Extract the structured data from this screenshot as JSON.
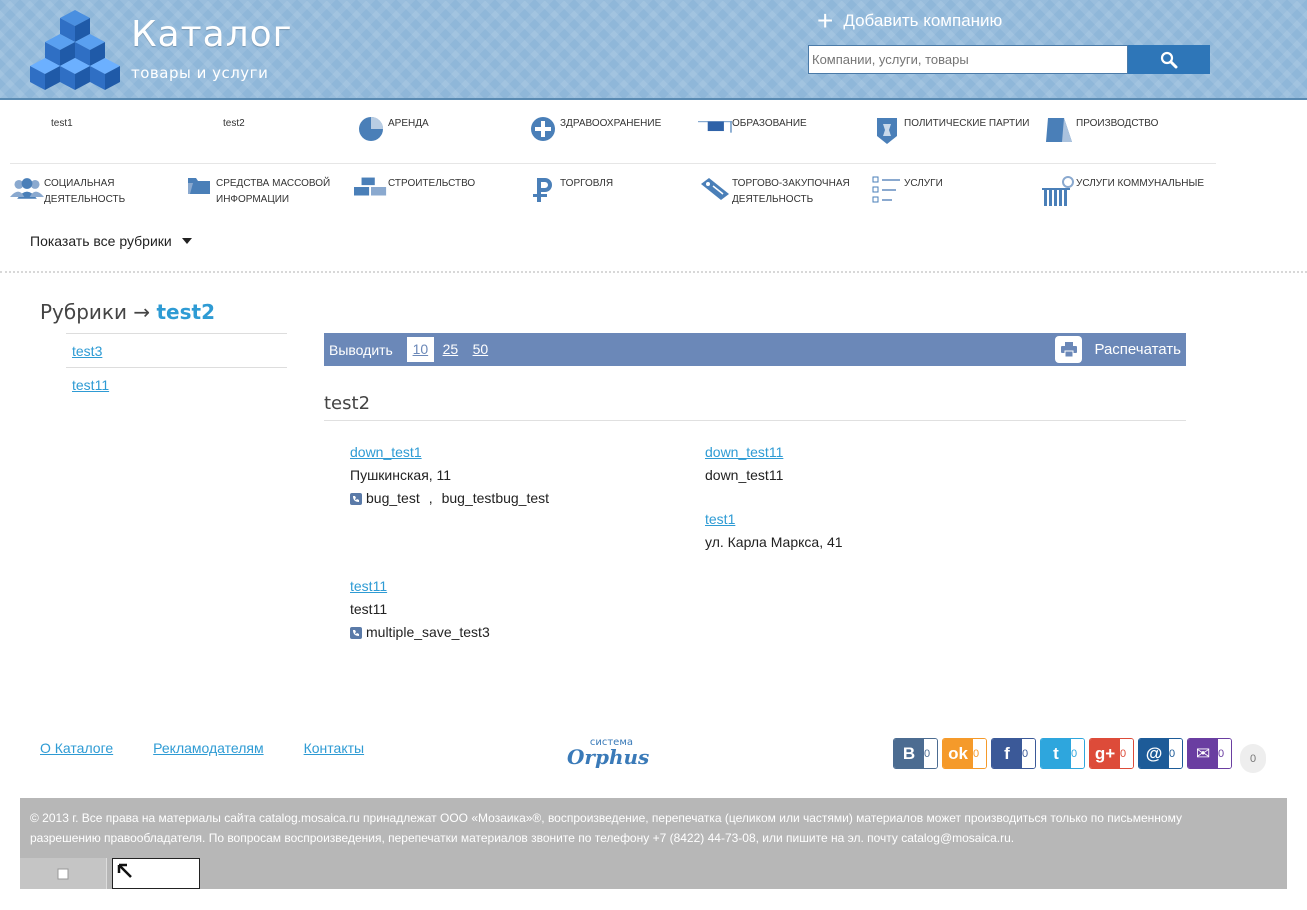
{
  "header": {
    "logo_title": "Каталог",
    "logo_subtitle": "товары и услуги",
    "add_company": "Добавить компанию",
    "search_placeholder": "Компании, услуги, товары"
  },
  "categories": {
    "row1": [
      {
        "label": "test1",
        "icon": "none"
      },
      {
        "label": "test2",
        "icon": "none"
      },
      {
        "label": "Аренда",
        "icon": "pie-chart-icon"
      },
      {
        "label": "Здравоохранение",
        "icon": "medical-cross-icon"
      },
      {
        "label": "Образование",
        "icon": "book-icon"
      },
      {
        "label": "Политические партии",
        "icon": "emblem-icon"
      },
      {
        "label": "Производство",
        "icon": "factory-icon"
      }
    ],
    "row2": [
      {
        "label": "Социальная деятельность",
        "icon": "people-icon"
      },
      {
        "label": "Средства массовой информации",
        "icon": "media-folder-icon"
      },
      {
        "label": "Строительство",
        "icon": "bricks-icon"
      },
      {
        "label": "Торговля",
        "icon": "ruble-icon"
      },
      {
        "label": "Торгово-закупочная деятельность",
        "icon": "tag-icon"
      },
      {
        "label": "Услуги",
        "icon": "checklist-icon"
      },
      {
        "label": "Услуги коммунальные",
        "icon": "radiator-icon"
      }
    ],
    "show_all": "Показать все рубрики"
  },
  "breadcrumb": {
    "root": "Рубрики",
    "arrow": "→",
    "current": "test2"
  },
  "rubrics": [
    "test3",
    "test11"
  ],
  "toolbar": {
    "show_label": "Выводить",
    "pages": [
      "10",
      "25",
      "50"
    ],
    "active_page": "10",
    "print_label": "Распечатать"
  },
  "section_title": "test2",
  "firms": {
    "f1": {
      "name": "down_test1",
      "address": "Пушкинская, 11",
      "phones_a": "bug_test",
      "sep": ",",
      "phones_b": "bug_testbug_test"
    },
    "f2": {
      "name": "down_test11",
      "address": "down_test11"
    },
    "f3": {
      "name": "test1",
      "address": "ул. Карла Маркса, 41"
    },
    "f4": {
      "name": "test11",
      "address": "test11",
      "phone": "multiple_save_test3"
    }
  },
  "footer": {
    "links": [
      "О Каталоге",
      "Рекламодателям",
      "Контакты"
    ],
    "orphus_top": "система",
    "orphus_name": "Orphus",
    "shares": [
      {
        "icon": "vk-icon",
        "glyph": "В",
        "count": "0",
        "color": "#4c6c91"
      },
      {
        "icon": "odnoklassniki-icon",
        "glyph": "ok",
        "count": "0",
        "color": "#f59a2a"
      },
      {
        "icon": "facebook-icon",
        "glyph": "f",
        "count": "0",
        "color": "#3b5998"
      },
      {
        "icon": "twitter-icon",
        "glyph": "t",
        "count": "0",
        "color": "#2ea6dd"
      },
      {
        "icon": "google-plus-icon",
        "glyph": "g+",
        "count": "0",
        "color": "#dd4b39"
      },
      {
        "icon": "mailru-icon",
        "glyph": "@",
        "count": "0",
        "color": "#1d5b98"
      },
      {
        "icon": "email-icon",
        "glyph": "✉",
        "count": "0",
        "color": "#6a3ea1"
      }
    ],
    "bubble_count": "0",
    "copyright_1": "© 2013 г. Все права на материалы сайта catalog.mosaica.ru принадлежат ООО «Мозаика»®, воспроизведение, перепечатка (целиком или частями) материалов может производиться только по письменному",
    "copyright_2": "разрешению правообладателя. По вопросам воспроизведения, перепечатки материалов звоните по телефону +7 (8422) 44-73-08, или пишите на эл. почту catalog@mosaica.ru."
  },
  "colors": {
    "accent": "#2e9bd4",
    "toolbar": "#6b88b8",
    "header": "#8fb7d9"
  }
}
